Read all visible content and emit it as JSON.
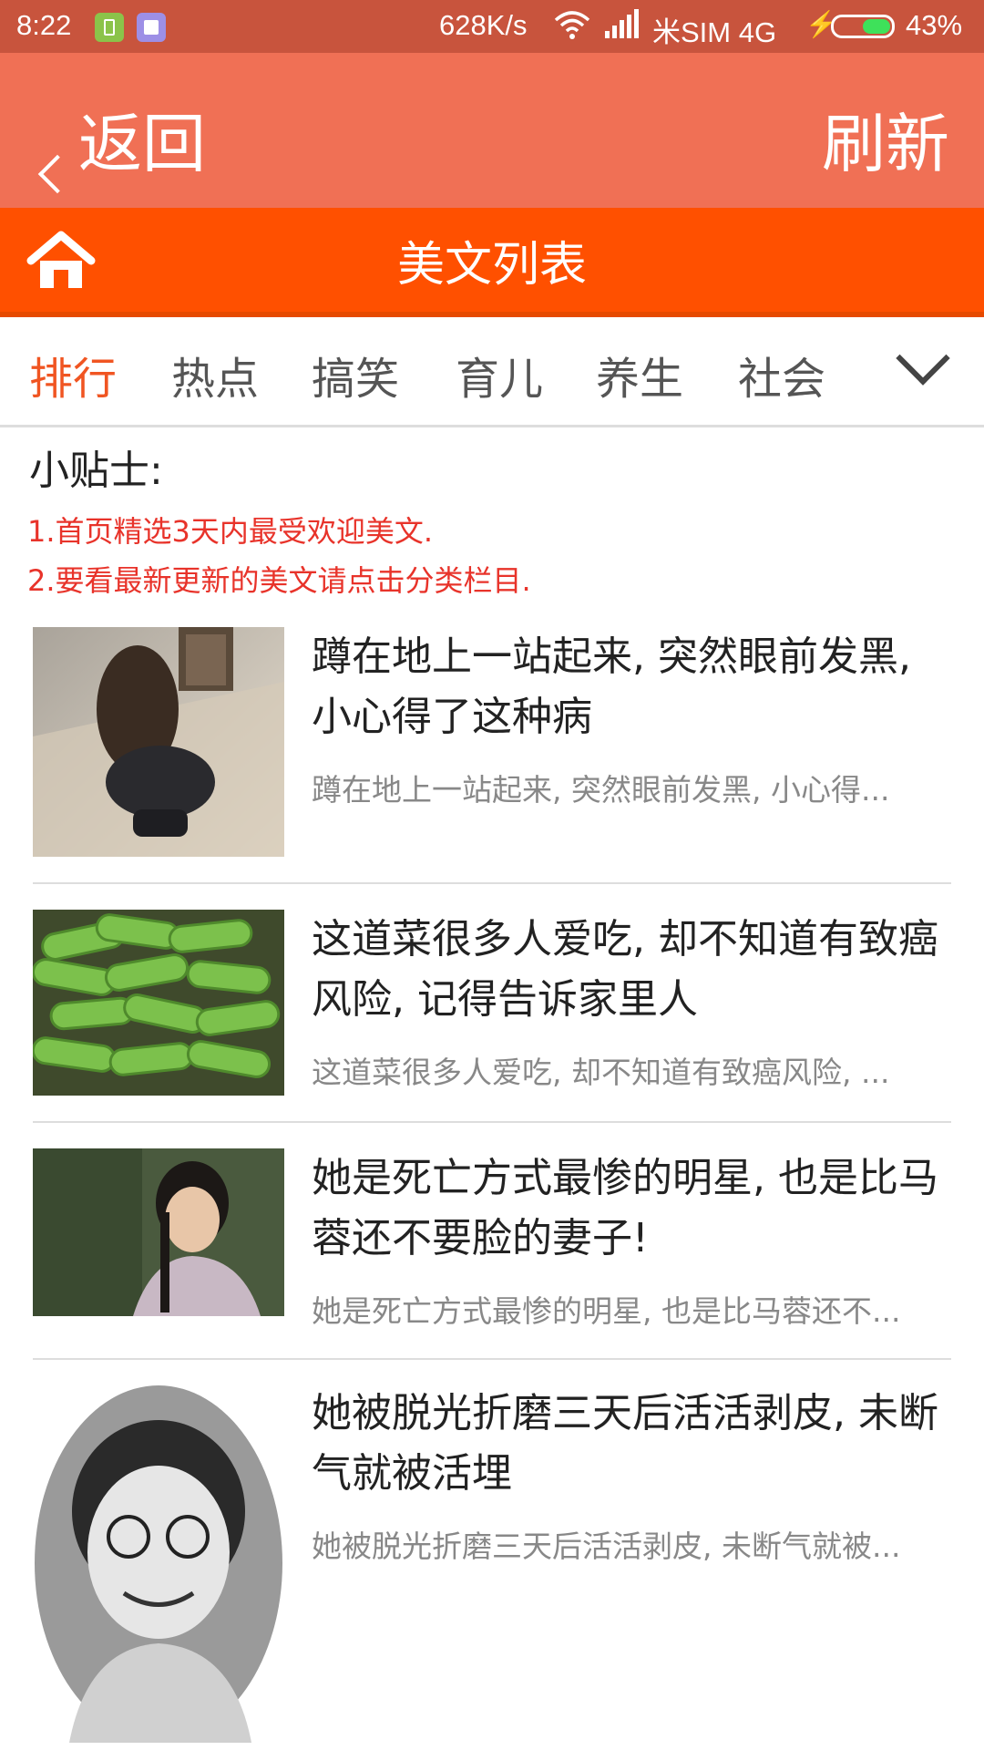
{
  "status_bar": {
    "time": "8:22",
    "speed": "628K/s",
    "carrier": "米SIM 4G",
    "battery_pct": "43%",
    "icons": [
      "app-notification-icon",
      "app-notification-icon-2",
      "wifi-icon",
      "signal-icon",
      "charging-icon",
      "battery-icon"
    ]
  },
  "titlebar": {
    "back_label": "返回",
    "refresh_label": "刷新"
  },
  "section": {
    "title": "美文列表",
    "icon": "home-icon"
  },
  "tabs": [
    {
      "label": "排行",
      "active": true
    },
    {
      "label": "热点"
    },
    {
      "label": "搞笑"
    },
    {
      "label": "育儿"
    },
    {
      "label": "养生"
    },
    {
      "label": "社会"
    }
  ],
  "tips": {
    "title": "小贴士:",
    "lines": [
      "1.首页精选3天内最受欢迎美文.",
      "2.要看最新更新的美文请点击分类栏目."
    ]
  },
  "articles": [
    {
      "title": "蹲在地上一站起来, 突然眼前发黑, 小心得了这种病",
      "summary": "蹲在地上一站起来, 突然眼前发黑, 小心得..."
    },
    {
      "title": "这道菜很多人爱吃, 却不知道有致癌风险, 记得告诉家里人",
      "summary": "这道菜很多人爱吃, 却不知道有致癌风险, ..."
    },
    {
      "title": "她是死亡方式最惨的明星, 也是比马蓉还不要脸的妻子!",
      "summary": "她是死亡方式最惨的明星, 也是比马蓉还不..."
    },
    {
      "title": "她被脱光折磨三天后活活剥皮, 未断气就被活埋",
      "summary": "她被脱光折磨三天后活活剥皮, 未断气就被..."
    }
  ],
  "colors": {
    "status_bar": "#c8543d",
    "title_bar": "#f07055",
    "section_bar": "#ff5000",
    "active_tab": "#f05522",
    "tip_text": "#e8332a"
  }
}
